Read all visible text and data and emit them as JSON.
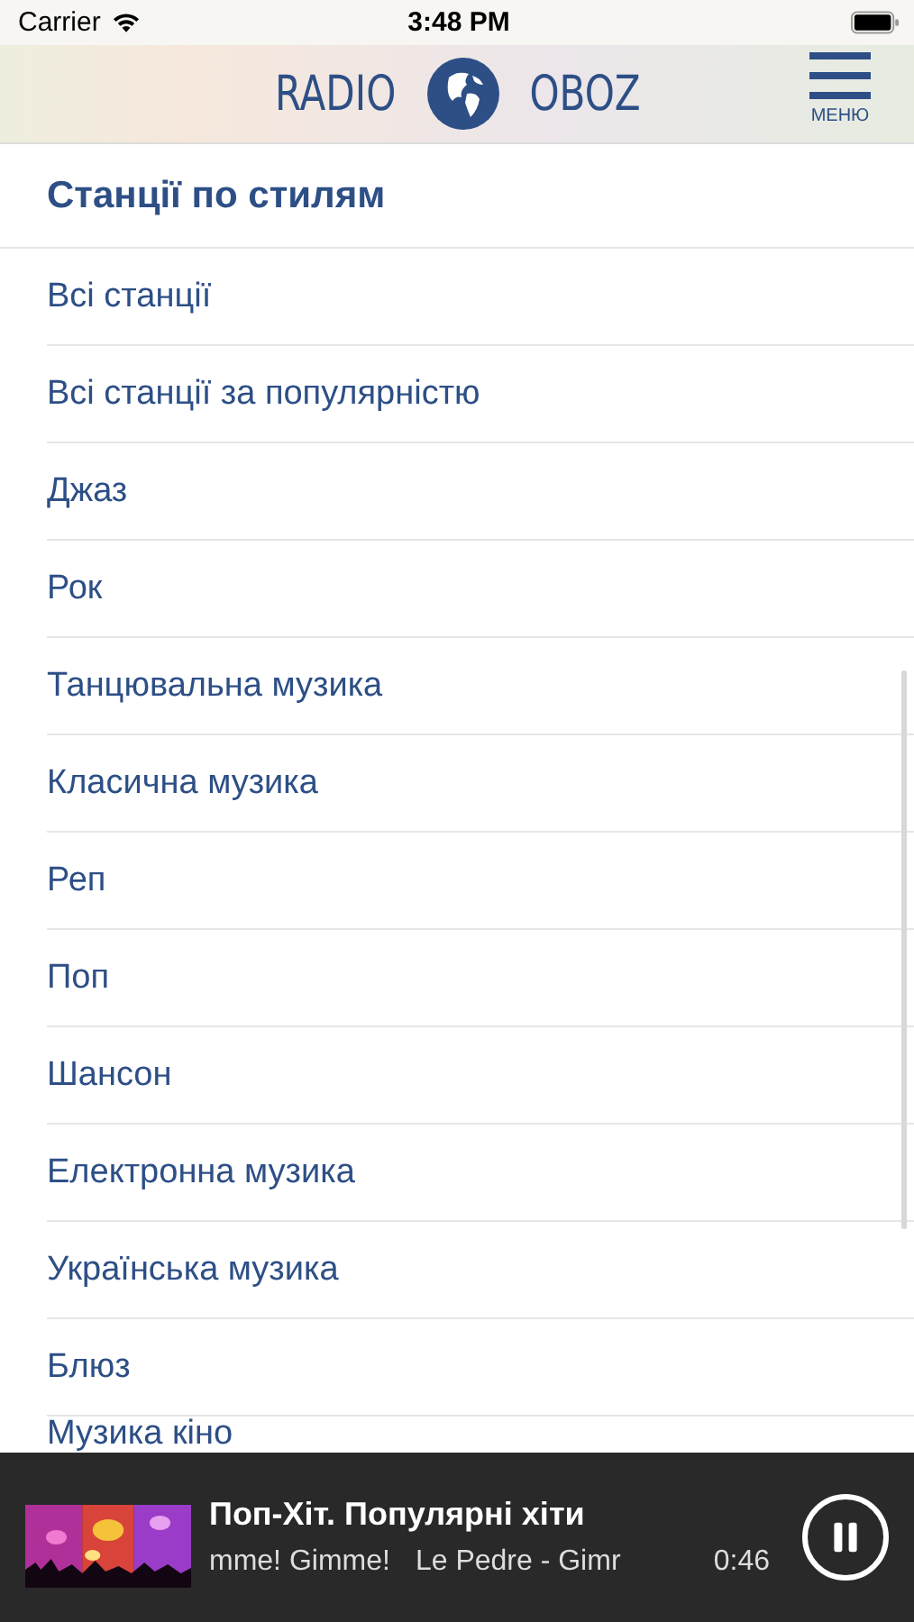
{
  "status_bar": {
    "carrier": "Carrier",
    "time": "3:48 PM"
  },
  "header": {
    "logo_left": "RADIO",
    "logo_right": "OBOZ",
    "menu_label": "МЕНЮ"
  },
  "section_title": "Станції по стилям",
  "items": [
    {
      "label": "Всі станції"
    },
    {
      "label": "Всі станції за популярністю"
    },
    {
      "label": "Джаз"
    },
    {
      "label": "Рок"
    },
    {
      "label": "Танцювальна музика"
    },
    {
      "label": "Класична музика"
    },
    {
      "label": "Реп"
    },
    {
      "label": "Поп"
    },
    {
      "label": "Шансон"
    },
    {
      "label": "Електронна музика"
    },
    {
      "label": "Українська музика"
    },
    {
      "label": "Блюз"
    },
    {
      "label": "Музика кіно"
    }
  ],
  "player": {
    "station": "Поп-Хіт. Популярні хіти",
    "track_parts": [
      "mme! Gimme!",
      "Le Pedre - Gimr"
    ],
    "elapsed": "0:46",
    "playing": true
  }
}
